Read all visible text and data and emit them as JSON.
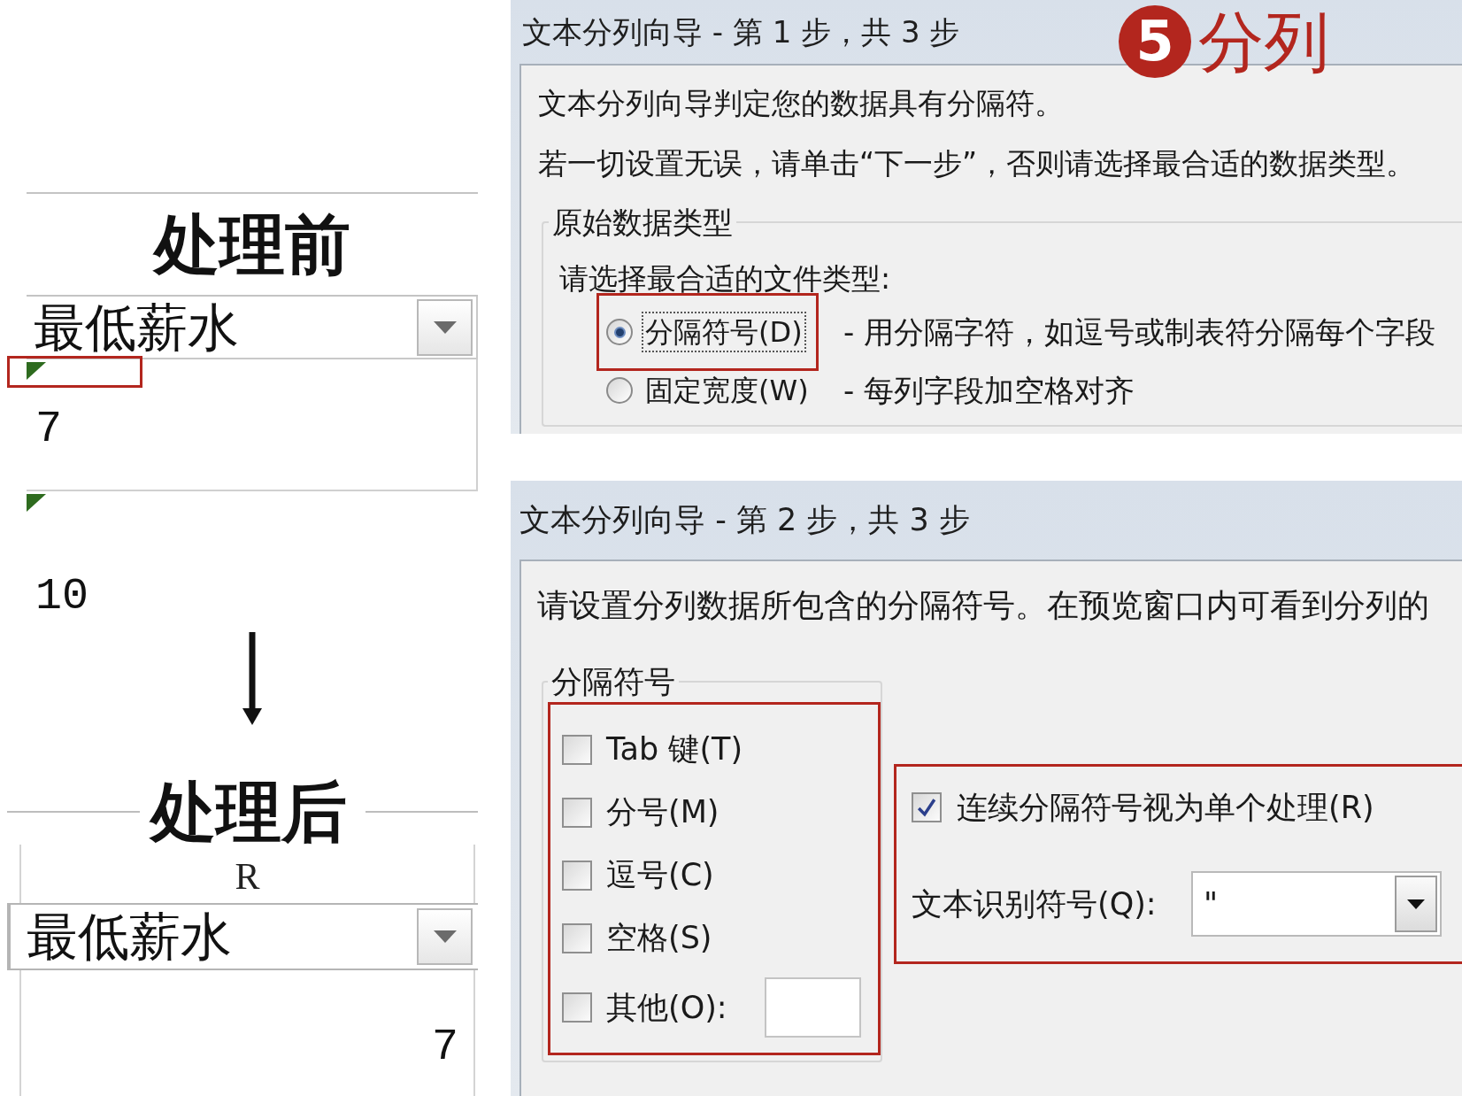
{
  "comparison": {
    "before": {
      "title": "处理前",
      "column_header": "最低薪水",
      "cells": [
        {
          "value": "7",
          "kind": "text",
          "error_marker": true,
          "highlighted": true
        },
        {
          "value": "10",
          "kind": "text",
          "error_marker": true,
          "highlighted": false
        }
      ]
    },
    "after": {
      "title": "处理后",
      "column_letter": "R",
      "column_header": "最低薪水",
      "cells": [
        {
          "value": "7",
          "kind": "number",
          "error_marker": false,
          "highlighted": false
        }
      ]
    }
  },
  "step1_dialog": {
    "title": "文本分列向导 - 第 1 步，共 3 步",
    "callout": {
      "number": "5",
      "label": "分列"
    },
    "intro": [
      "文本分列向导判定您的数据具有分隔符。",
      "若一切设置无误，请单击“下一步”，否则请选择最合适的数据类型。"
    ],
    "group": {
      "title": "原始数据类型",
      "prompt": "请选择最合适的文件类型:",
      "options": [
        {
          "label": "分隔符号(D)",
          "description": "- 用分隔字符，如逗号或制表符分隔每个字段",
          "selected": true,
          "highlighted": true
        },
        {
          "label": "固定宽度(W)",
          "description": "- 每列字段加空格对齐",
          "selected": false,
          "highlighted": false
        }
      ]
    }
  },
  "step2_dialog": {
    "title": "文本分列向导 - 第 2 步，共 3 步",
    "intro": "请设置分列数据所包含的分隔符号。在预览窗口内可看到分列的",
    "delimiters": {
      "title": "分隔符号",
      "highlighted": true,
      "options": [
        {
          "label": "Tab 键(T)",
          "kind": "plain",
          "checked": false
        },
        {
          "label": "分号(M)",
          "kind": "plain",
          "checked": false
        },
        {
          "label": "逗号(C)",
          "kind": "plain",
          "checked": false
        },
        {
          "label": "空格(S)",
          "kind": "plain",
          "checked": false
        },
        {
          "label": "其他(O):",
          "kind": "input",
          "checked": false
        }
      ]
    },
    "options_box": {
      "highlighted": true,
      "consecutive": {
        "label": "连续分隔符号视为单个处理(R)",
        "checked": true
      },
      "qualifier": {
        "label": "文本识别符号(Q):",
        "value": "\""
      }
    }
  }
}
